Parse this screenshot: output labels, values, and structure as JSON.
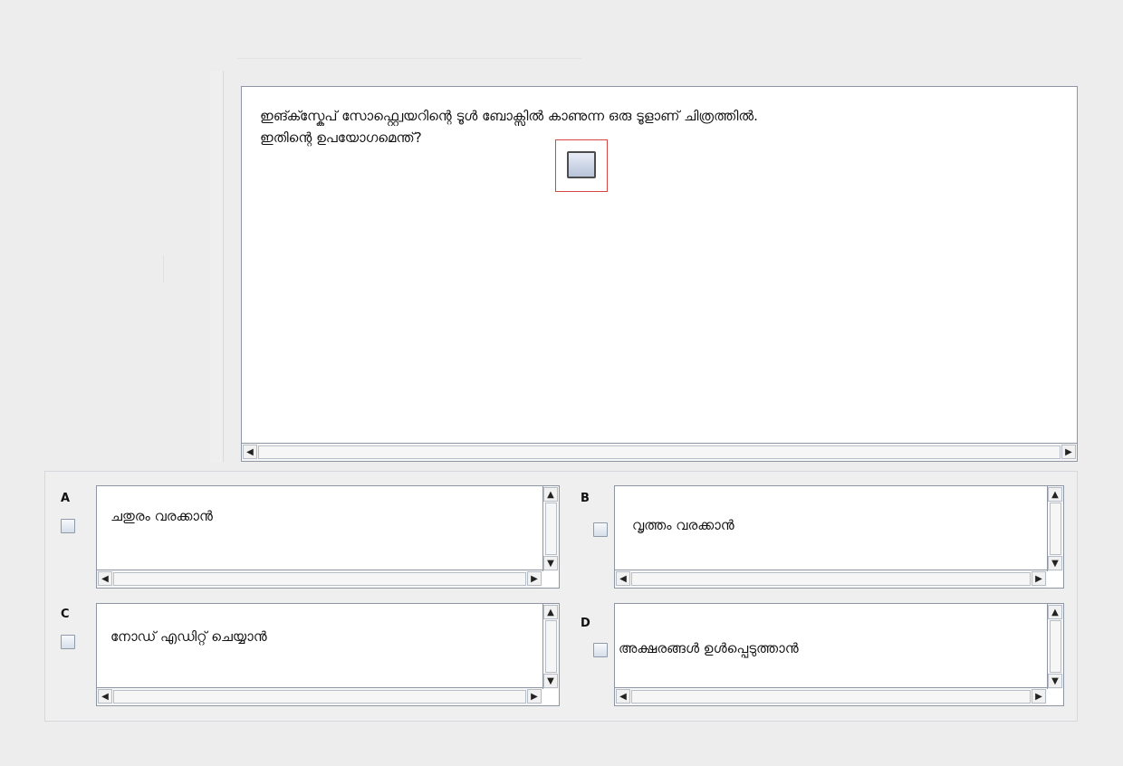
{
  "question": {
    "line1": "ഇങ്ക്സ്കേപ് സോഫ്റ്റ്വെയറിന്റെ ടൂള്‍ ബോക്സില്‍ കാണുന്ന ഒരു ടൂളാണ് ചിത്രത്തില്‍.",
    "line2": "ഇതിന്റെ ഉപയോഗമെന്ത്?",
    "icon_name": "rectangle-tool-icon"
  },
  "options": [
    {
      "label": "A",
      "text": "ചതുരം വരക്കാന്‍"
    },
    {
      "label": "B",
      "text": "വൃത്തം വരക്കാന്‍"
    },
    {
      "label": "C",
      "text": "നോഡ് എഡിറ്റ് ചെയ്യാന്‍"
    },
    {
      "label": "D",
      "text": "അക്ഷരങ്ങള്‍ ഉള്‍പ്പെടുത്താന്‍"
    }
  ],
  "scrollbar_glyphs": {
    "left": "◀",
    "right": "▶",
    "up": "▲",
    "down": "▼"
  },
  "colors": {
    "panel_border": "#8f96a3",
    "icon_highlight": "#d84545",
    "background": "#ededed"
  }
}
